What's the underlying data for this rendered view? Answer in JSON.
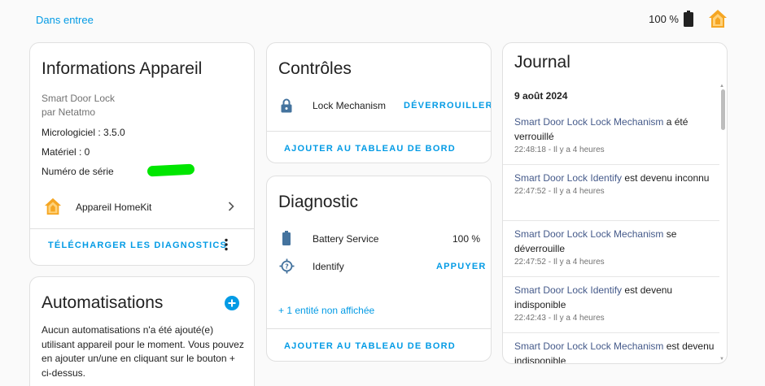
{
  "topbar": {
    "back_link": "Dans entree",
    "battery_value": "100 %"
  },
  "info": {
    "title": "Informations Appareil",
    "model": "Smart Door Lock",
    "manufacturer": "par Netatmo",
    "firmware": "Micrologiciel : 3.5.0",
    "hardware": "Matériel : 0",
    "serial_label": "Numéro de série",
    "homekit_label": "Appareil HomeKit",
    "download_label": "TÉLÉCHARGER LES DIAGNOSTICS"
  },
  "automations": {
    "title": "Automatisations",
    "description": "Aucun automatisations n'a été ajouté(e) utilisant appareil pour le moment. Vous pouvez en ajouter un/une en cliquant sur le bouton + ci-dessus."
  },
  "controls": {
    "title": "Contrôles",
    "entity_label": "Lock Mechanism",
    "entity_action": "DÉVERROUILLER",
    "add_to_dashboard": "AJOUTER AU TABLEAU DE BORD"
  },
  "diagnostic": {
    "title": "Diagnostic",
    "battery_label": "Battery Service",
    "battery_value": "100 %",
    "identify_label": "Identify",
    "identify_action": "APPUYER",
    "hidden_entities": "+ 1 entité non affichée",
    "add_to_dashboard": "AJOUTER AU TABLEAU DE BORD"
  },
  "journal": {
    "title": "Journal",
    "date": "9 août 2024",
    "entries": [
      {
        "entity": "Smart Door Lock Lock Mechanism",
        "rest": " a été verrouillé",
        "time": "22:48:18 - Il y a 4 heures"
      },
      {
        "entity": "Smart Door Lock Identify",
        "rest": " est devenu inconnu",
        "time": "22:47:52 - Il y a 4 heures"
      },
      {
        "entity": "Smart Door Lock Lock Mechanism",
        "rest": " se déverrouille",
        "time": "22:47:52 - Il y a 4 heures"
      },
      {
        "entity": "Smart Door Lock Identify",
        "rest": " est devenu indisponible",
        "time": "22:42:43 - Il y a 4 heures"
      },
      {
        "entity": "Smart Door Lock Lock Mechanism",
        "rest": " est devenu indisponible",
        "time": ""
      }
    ]
  },
  "colors": {
    "accent": "#039be5",
    "homekit_orange": "#f5a623",
    "icon_dark": "#44739e"
  }
}
